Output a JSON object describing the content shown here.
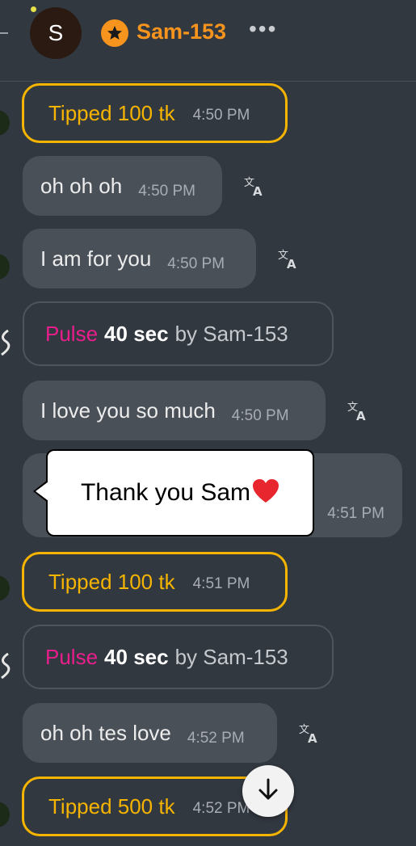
{
  "header": {
    "avatar_letter": "S",
    "name": "Sam-153",
    "more": "•••"
  },
  "messages": [
    {
      "type": "tip",
      "text": "Tipped 100 tk",
      "time": "4:50 PM"
    },
    {
      "type": "text",
      "text": "oh oh oh",
      "time": "4:50 PM"
    },
    {
      "type": "text",
      "text": "I am for you",
      "time": "4:50 PM"
    },
    {
      "type": "pulse",
      "keyword": "Pulse",
      "duration": "40 sec",
      "by": "by Sam-153"
    },
    {
      "type": "text",
      "text": "I love you so much",
      "time": "4:50 PM"
    },
    {
      "type": "text_partial",
      "text": "",
      "time": "4:51 PM"
    },
    {
      "type": "tip",
      "text": "Tipped 100 tk",
      "time": "4:51 PM"
    },
    {
      "type": "pulse",
      "keyword": "Pulse",
      "duration": "40 sec",
      "by": "by Sam-153"
    },
    {
      "type": "text",
      "text": "oh oh tes love",
      "time": "4:52 PM"
    },
    {
      "type": "tip",
      "text": "Tipped 500 tk",
      "time": "4:52 PM"
    }
  ],
  "popup": {
    "text": "Thank you Sam"
  },
  "colors": {
    "accent": "#f7941d",
    "tip_border": "#f5b400",
    "pulse_pink": "#e91e8c",
    "background": "#323840",
    "bubble": "#4a5058"
  },
  "icons": [
    "back-icon",
    "star-icon",
    "more-icon",
    "translate-icon",
    "heart-icon",
    "arrow-down-icon"
  ]
}
